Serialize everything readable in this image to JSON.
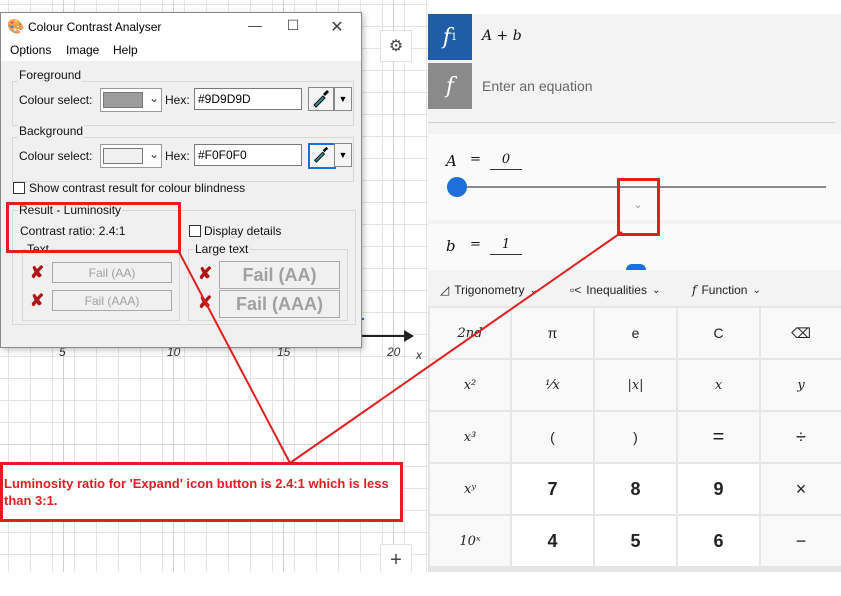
{
  "graph": {
    "x_ticks": [
      "5",
      "10",
      "15",
      "20"
    ],
    "x_axis_label": "x",
    "zoom_in_symbol": "+"
  },
  "right_panel": {
    "equations": [
      {
        "badge": "f",
        "subscript": "1",
        "text": "A + b",
        "badge_color": "#1f5ea6"
      },
      {
        "badge": "f",
        "placeholder": "Enter an equation",
        "badge_color": "#8a8a8a"
      }
    ],
    "sliders": [
      {
        "name": "A",
        "equals": "=",
        "value": "0",
        "fraction": 0.0
      },
      {
        "name": "b",
        "equals": "=",
        "value": "1"
      }
    ],
    "toolbar": [
      {
        "label": "Trigonometry",
        "icon": "triangle-ruler-icon"
      },
      {
        "label": "Inequalities",
        "icon": "inequality-icon"
      },
      {
        "label": "Function",
        "icon": "function-f-icon"
      }
    ],
    "keypad": [
      [
        "2nd",
        "π",
        "e",
        "C",
        "⌫"
      ],
      [
        "x²",
        "¹⁄x",
        "|x|",
        "x",
        "y"
      ],
      [
        "x³",
        "(",
        ")",
        "=",
        "÷"
      ],
      [
        "xʸ",
        "7",
        "8",
        "9",
        "×"
      ],
      [
        "10ˣ",
        "4",
        "5",
        "6",
        "−"
      ]
    ],
    "accent_color": "#1e6fd9"
  },
  "cca": {
    "title": "Colour Contrast Analyser",
    "menu": [
      "Options",
      "Image",
      "Help"
    ],
    "foreground": {
      "group_title": "Foreground",
      "select_label": "Colour select:",
      "hex_label": "Hex:",
      "hex_value": "#9D9D9D",
      "swatch_color": "#9D9D9D"
    },
    "background": {
      "group_title": "Background",
      "select_label": "Colour select:",
      "hex_label": "Hex:",
      "hex_value": "#F0F0F0",
      "swatch_color": "#F0F0F0"
    },
    "blindness_checkbox_label": "Show contrast result for colour blindness",
    "result": {
      "group_title": "Result - Luminosity",
      "contrast_ratio": "Contrast ratio: 2.4:1",
      "display_details": "Display details",
      "text_group": "Text",
      "large_text_group": "Large text",
      "text_fail_aa": "Fail (AA)",
      "text_fail_aaa": "Fail (AAA)",
      "large_fail_aa": "Fail (AA)",
      "large_fail_aaa": "Fail (AAA)"
    }
  },
  "annotation": {
    "text": "Luminosity ratio for 'Expand' icon button is 2.4:1 which is less than 3:1.",
    "color": "#e02020"
  }
}
